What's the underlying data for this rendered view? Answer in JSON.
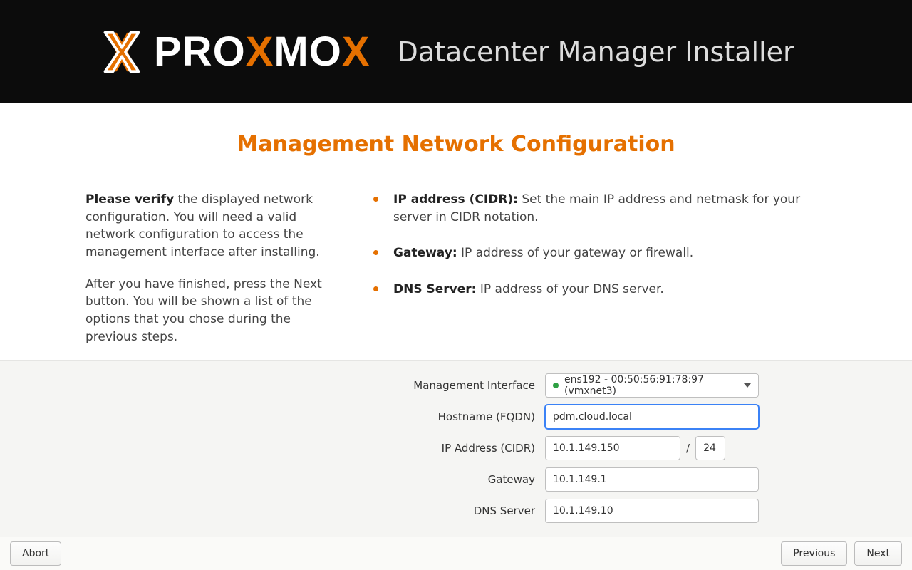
{
  "header": {
    "brand_prefix": "PRO",
    "brand_mid": "X",
    "brand_after": "MO",
    "brand_suffix": "X",
    "title": "Datacenter Manager Installer"
  },
  "page": {
    "title": "Management Network Configuration",
    "intro_strong": "Please verify",
    "intro_rest": " the displayed network configuration. You will need a valid network configuration to access the management interface after installing.",
    "intro2": "After you have finished, press the Next button. You will be shown a list of the options that you chose during the previous steps.",
    "bullets": [
      {
        "strong": "IP address (CIDR):",
        "rest": " Set the main IP address and netmask for your server in CIDR notation."
      },
      {
        "strong": "Gateway:",
        "rest": " IP address of your gateway or firewall."
      },
      {
        "strong": "DNS Server:",
        "rest": " IP address of your DNS server."
      }
    ]
  },
  "form": {
    "labels": {
      "interface": "Management Interface",
      "hostname": "Hostname (FQDN)",
      "ip": "IP Address (CIDR)",
      "gateway": "Gateway",
      "dns": "DNS Server"
    },
    "interface_text": "ens192 - 00:50:56:91:78:97 (vmxnet3)",
    "hostname": "pdm.cloud.local",
    "ip": "10.1.149.150",
    "cidr": "24",
    "gateway": "10.1.149.1",
    "dns": "10.1.149.10"
  },
  "footer": {
    "abort": "Abort",
    "previous": "Previous",
    "next": "Next"
  }
}
